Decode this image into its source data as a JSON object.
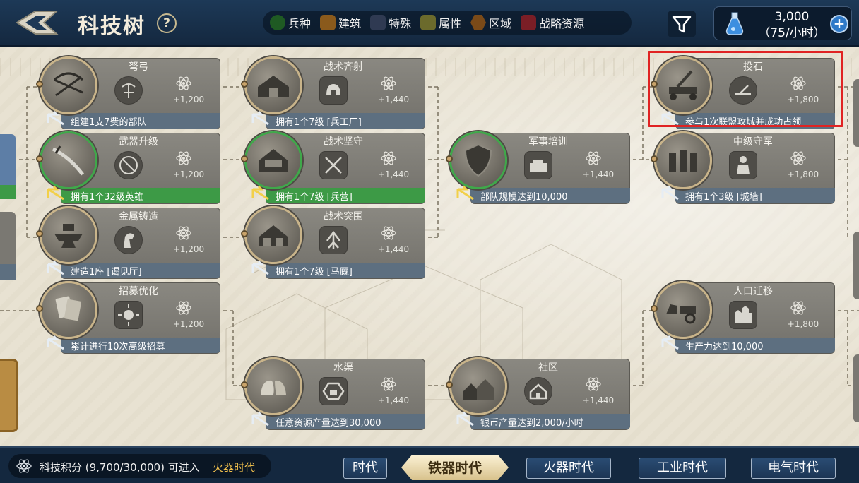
{
  "header": {
    "title": "科技树",
    "help": "?",
    "legend": [
      {
        "label": "兵种",
        "color": "#1f5a23",
        "shape": "round"
      },
      {
        "label": "建筑",
        "color": "#8a5a1c",
        "shape": "square"
      },
      {
        "label": "特殊",
        "color": "#2f3a52",
        "shape": "square"
      },
      {
        "label": "属性",
        "color": "#6b6a2c",
        "shape": "square"
      },
      {
        "label": "区域",
        "color": "#7a4a18",
        "shape": "hex"
      },
      {
        "label": "战略资源",
        "color": "#7a1e26",
        "shape": "square"
      }
    ],
    "resource_amount": "3,000",
    "resource_rate": "（75/小时）",
    "add": "+"
  },
  "nodes": [
    {
      "name": "弩弓",
      "req": "组建1支7费的部队",
      "cost": "+1,200",
      "status": "locked"
    },
    {
      "name": "武器升级",
      "req": "拥有1个32级英雄",
      "cost": "+1,200",
      "status": "done"
    },
    {
      "name": "金属铸造",
      "req": "建造1座 [谒见厅]",
      "cost": "+1,200",
      "status": "locked"
    },
    {
      "name": "招募优化",
      "req": "累计进行10次高级招募",
      "cost": "+1,200",
      "status": "locked"
    },
    {
      "name": "战术齐射",
      "req": "拥有1个7级 [兵工厂]",
      "cost": "+1,440",
      "status": "locked"
    },
    {
      "name": "战术坚守",
      "req": "拥有1个7级 [兵营]",
      "cost": "+1,440",
      "status": "done"
    },
    {
      "name": "战术突围",
      "req": "拥有1个7级 [马厩]",
      "cost": "+1,440",
      "status": "locked"
    },
    {
      "name": "水渠",
      "req": "任意资源产量达到30,000",
      "cost": "+1,440",
      "status": "locked"
    },
    {
      "name": "军事培训",
      "req": "部队规模达到10,000",
      "cost": "+1,440",
      "status": "locked"
    },
    {
      "name": "社区",
      "req": "银币产量达到2,000/小时",
      "cost": "+1,440",
      "status": "locked"
    },
    {
      "name": "投石",
      "req": "参与1次联盟攻城并成功占领",
      "cost": "+1,800",
      "status": "locked"
    },
    {
      "name": "中级守军",
      "req": "拥有1个3级 [城墙]",
      "cost": "+1,800",
      "status": "locked"
    },
    {
      "name": "人口迁移",
      "req": "生产力达到10,000",
      "cost": "+1,800",
      "status": "locked"
    }
  ],
  "footer": {
    "score_text": "科技积分 (9,700/30,000)  可进入",
    "next_era": "火器时代",
    "tabs": [
      {
        "label": "时代",
        "state": "normal"
      },
      {
        "label": "铁器时代",
        "state": "active"
      },
      {
        "label": "火器时代",
        "state": "normal"
      },
      {
        "label": "工业时代",
        "state": "normal"
      },
      {
        "label": "电气时代",
        "state": "normal"
      }
    ]
  }
}
